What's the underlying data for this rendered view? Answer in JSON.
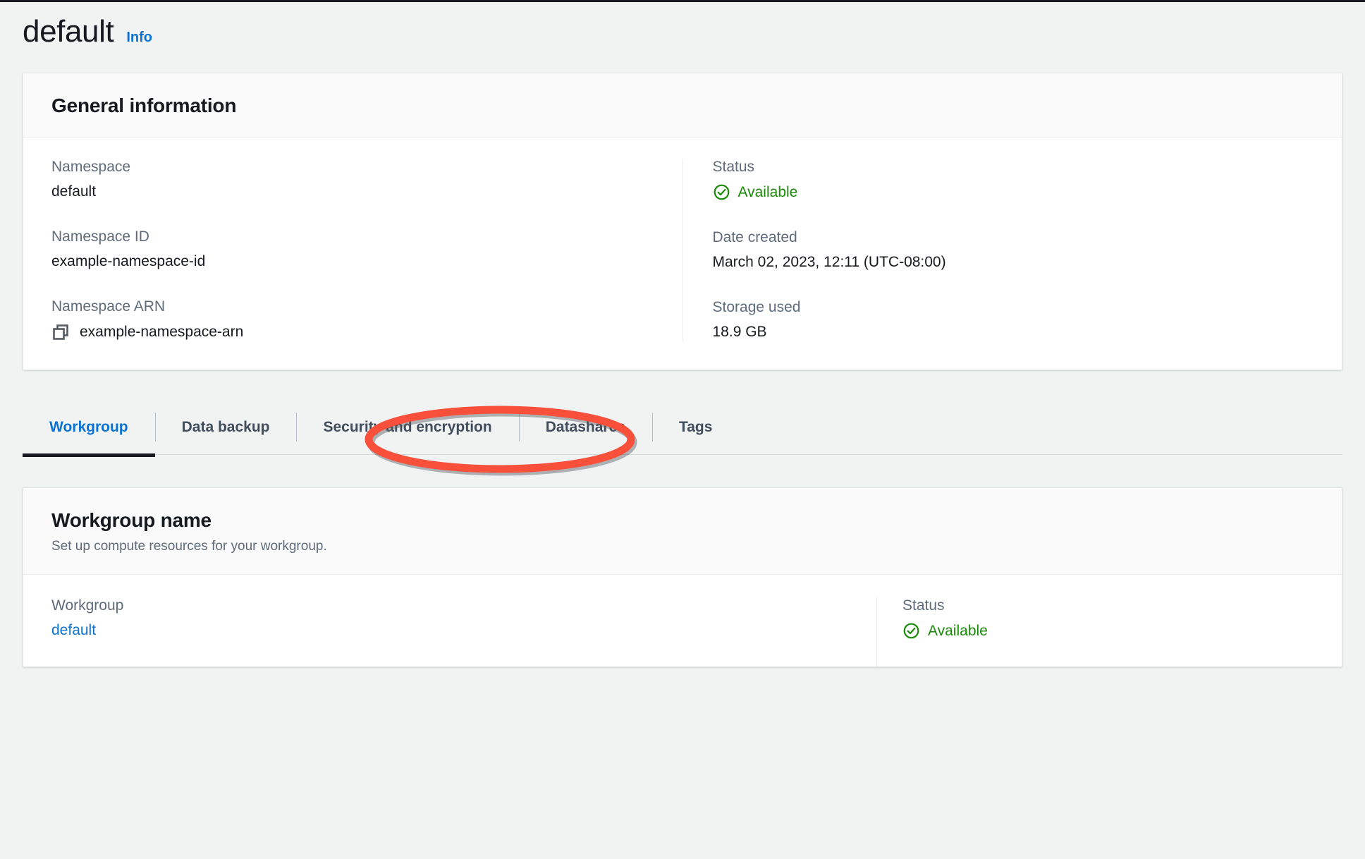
{
  "header": {
    "title": "default",
    "info_label": "Info"
  },
  "general_information": {
    "heading": "General information",
    "left_fields": [
      {
        "label": "Namespace",
        "value": "default"
      },
      {
        "label": "Namespace ID",
        "value": "example-namespace-id"
      },
      {
        "label": "Namespace ARN",
        "value": "example-namespace-arn",
        "icon": "copy-icon"
      }
    ],
    "right_fields": [
      {
        "label": "Status",
        "value": "Available",
        "icon": "status-available-icon"
      },
      {
        "label": "Date created",
        "value": "March 02, 2023, 12:11 (UTC-08:00)"
      },
      {
        "label": "Storage used",
        "value": "18.9 GB"
      }
    ]
  },
  "tabs": [
    {
      "label": "Workgroup",
      "active": true
    },
    {
      "label": "Data backup",
      "active": false
    },
    {
      "label": "Security and encryption",
      "active": false,
      "annotated": true
    },
    {
      "label": "Datashares",
      "active": false
    },
    {
      "label": "Tags",
      "active": false
    }
  ],
  "workgroup_section": {
    "heading": "Workgroup name",
    "subtitle": "Set up compute resources for your workgroup.",
    "workgroup_label": "Workgroup",
    "workgroup_value": "default",
    "status_label": "Status",
    "status_value": "Available"
  },
  "colors": {
    "accent_link": "#0972d3",
    "status_success": "#1a8a07",
    "annotation_red": "#f9503c",
    "text_label": "#5f6b7a",
    "text_primary": "#16191f",
    "page_background": "#f1f3f3"
  }
}
